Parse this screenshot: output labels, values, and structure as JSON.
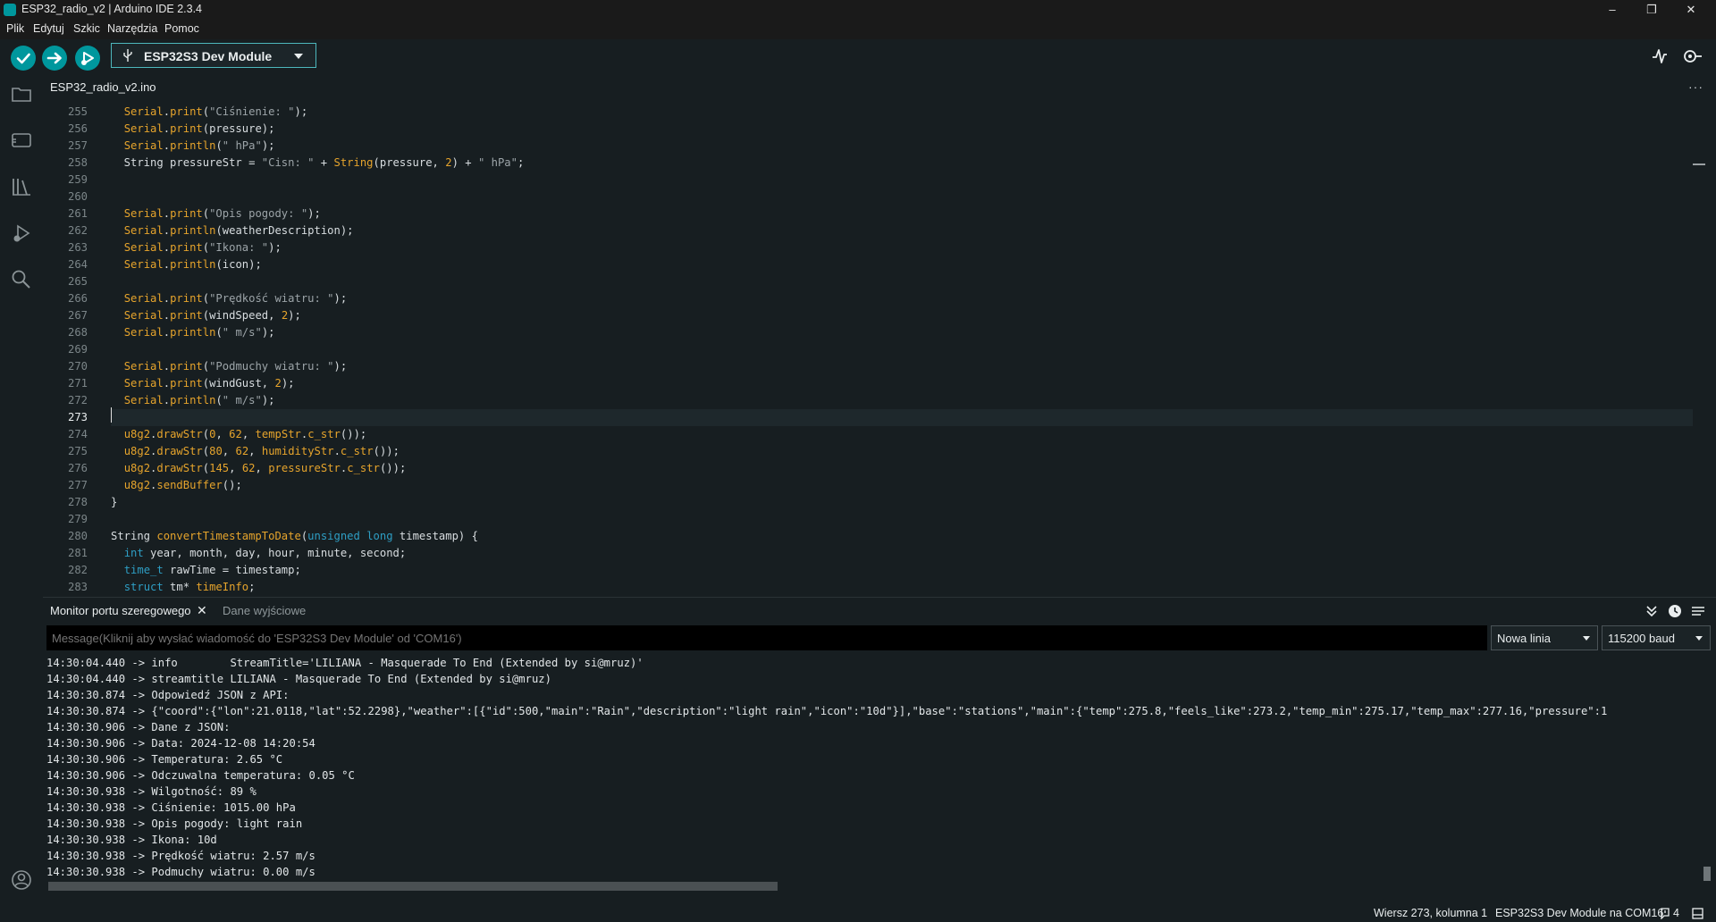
{
  "window": {
    "title": "ESP32_radio_v2 | Arduino IDE 2.3.4",
    "controls": [
      "–",
      "❐",
      "✕"
    ]
  },
  "menu": [
    "Plik",
    "Edytuj",
    "Szkic",
    "Narzędzia",
    "Pomoc"
  ],
  "toolbar": {
    "verify_icon": "check-icon",
    "upload_icon": "arrow-right-icon",
    "debug_icon": "debug-icon",
    "board": "ESP32S3 Dev Module",
    "serial_plotter_icon": "plotter-icon",
    "serial_monitor_icon": "serial-monitor-icon"
  },
  "activity_bar": [
    "folder-icon",
    "boards-manager-icon",
    "library-manager-icon",
    "debug-icon",
    "search-icon",
    "account-icon"
  ],
  "editor": {
    "tab": "ESP32_radio_v2.ino",
    "more": "···",
    "line_numbers": [
      "255",
      "256",
      "257",
      "258",
      "259",
      "260",
      "261",
      "262",
      "263",
      "264",
      "265",
      "266",
      "267",
      "268",
      "269",
      "270",
      "271",
      "272",
      "273",
      "274",
      "275",
      "276",
      "277",
      "278",
      "279",
      "280",
      "281",
      "282",
      "283"
    ],
    "current_line": "273"
  },
  "serial_panel": {
    "tabs": [
      "Monitor portu szeregowego",
      "Dane wyjściowe"
    ],
    "close": "✕",
    "message_placeholder": "Message(Kliknij aby wysłać wiadomość do 'ESP32S3 Dev Module' od 'COM16')",
    "line_ending": "Nowa linia",
    "baud": "115200 baud",
    "output": [
      "14:30:04.440 -> info        StreamTitle='LILIANA - Masquerade To End (Extended by si@mruz)'",
      "14:30:04.440 -> streamtitle LILIANA - Masquerade To End (Extended by si@mruz)",
      "14:30:30.874 -> Odpowiedź JSON z API:",
      "14:30:30.874 -> {\"coord\":{\"lon\":21.0118,\"lat\":52.2298},\"weather\":[{\"id\":500,\"main\":\"Rain\",\"description\":\"light rain\",\"icon\":\"10d\"}],\"base\":\"stations\",\"main\":{\"temp\":275.8,\"feels_like\":273.2,\"temp_min\":275.17,\"temp_max\":277.16,\"pressure\":1",
      "14:30:30.906 -> Dane z JSON:",
      "14:30:30.906 -> Data: 2024-12-08 14:20:54",
      "14:30:30.906 -> Temperatura: 2.65 °C",
      "14:30:30.906 -> Odczuwalna temperatura: 0.05 °C",
      "14:30:30.938 -> Wilgotność: 89 %",
      "14:30:30.938 -> Ciśnienie: 1015.00 hPa",
      "14:30:30.938 -> Opis pogody: light rain",
      "14:30:30.938 -> Ikona: 10d",
      "14:30:30.938 -> Prędkość wiatru: 2.57 m/s",
      "14:30:30.938 -> Podmuchy wiatru: 0.00 m/s"
    ]
  },
  "status": {
    "position": "Wiersz 273, kolumna 1",
    "board_port": "ESP32S3 Dev Module na COM16",
    "notifications": "4"
  },
  "colors": {
    "accent": "#00979d",
    "background": "#171e21",
    "keyword_orange": "#e6a42c",
    "type_blue": "#2e9ec4"
  }
}
